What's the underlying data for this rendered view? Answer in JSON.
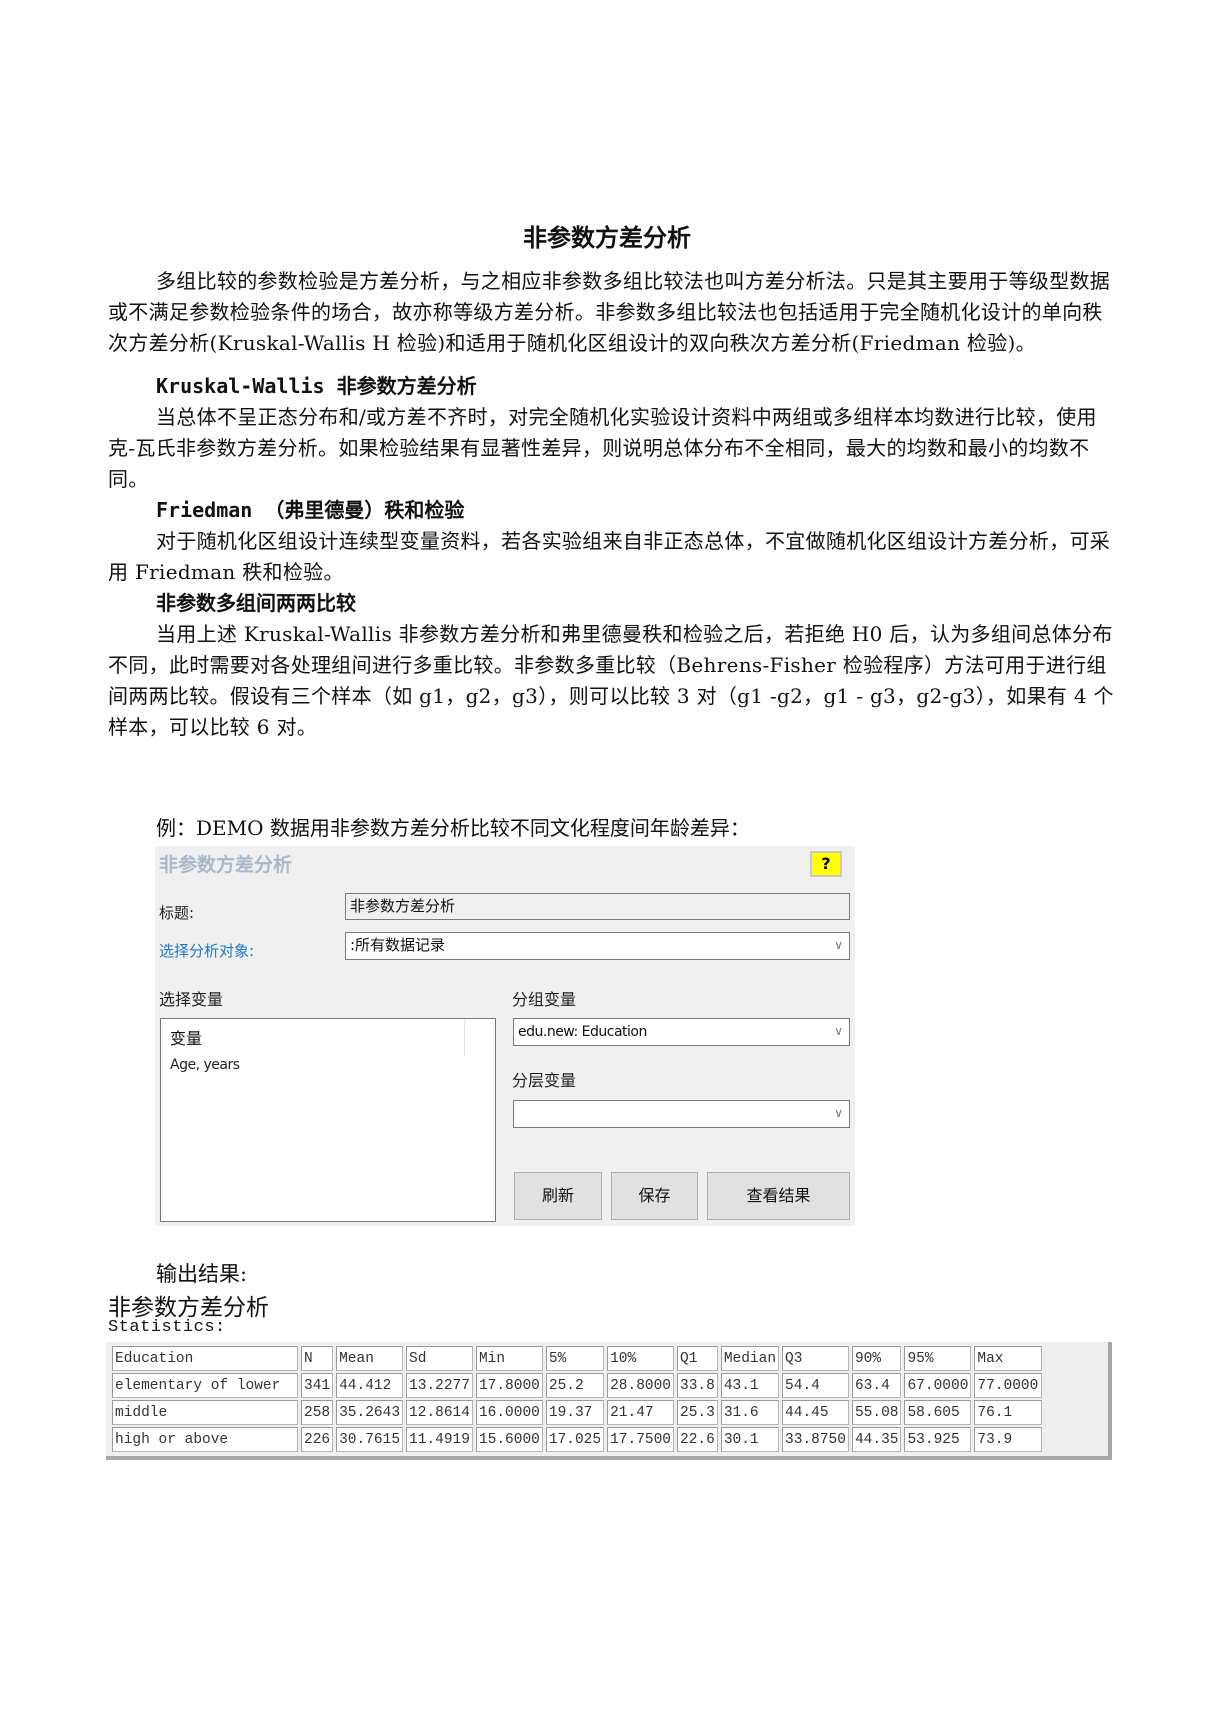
{
  "document": {
    "title": "非参数方差分析",
    "intro": "多组比较的参数检验是方差分析，与之相应非参数多组比较法也叫方差分析法。只是其主要用于等级型数据或不满足参数检验条件的场合，故亦称等级方差分析。非参数多组比较法也包括适用于完全随机化设计的单向秩次方差分析(Kruskal-Wallis H 检验)和适用于随机化区组设计的双向秩次方差分析(Friedman 检验)。",
    "sections": [
      {
        "heading_latin": "Kruskal-Wallis ",
        "heading_cn": "非参数方差分析",
        "body": "当总体不呈正态分布和/或方差不齐时，对完全随机化实验设计资料中两组或多组样本均数进行比较，使用克-瓦氏非参数方差分析。如果检验结果有显著性差异，则说明总体分布不全相同，最大的均数和最小的均数不同。"
      },
      {
        "heading_latin": "Friedman ",
        "heading_cn": "（弗里德曼）秩和检验",
        "body": "对于随机化区组设计连续型变量资料，若各实验组来自非正态总体，不宜做随机化区组设计方差分析，可采用 Friedman 秩和检验。"
      },
      {
        "heading_latin": "",
        "heading_cn": "非参数多组间两两比较",
        "body": "当用上述 Kruskal-Wallis 非参数方差分析和弗里德曼秩和检验之后，若拒绝 H0 后，认为多组间总体分布不同，此时需要对各处理组间进行多重比较。非参数多重比较（Behrens-Fisher 检验程序）方法可用于进行组间两两比较。假设有三个样本（如 g1，g2，g3），则可以比较 3 对（g1 -g2，g1 - g3，g2-g3），如果有 4 个样本，可以比较 6 对。"
      }
    ],
    "example_caption": "例：DEMO 数据用非参数方差分析比较不同文化程度间年龄差异："
  },
  "dialog": {
    "title": "非参数方差分析",
    "help_label": "?",
    "title_field_label": "标题:",
    "title_field_value": "非参数方差分析",
    "target_label": "选择分析对象:",
    "target_value": ":所有数据记录",
    "variables_label": "选择变量",
    "variables_header": "变量",
    "variables": [
      "Age, years"
    ],
    "group_label": "分组变量",
    "group_value": "edu.new: Education",
    "strata_label": "分层变量",
    "strata_value": "",
    "buttons": {
      "refresh": "刷新",
      "save": "保存",
      "view_results": "查看结果"
    },
    "colors": {
      "help_bg": "#ffff00",
      "link_label": "#1e78c8",
      "title": "#a9b8c9"
    }
  },
  "output": {
    "label": "输出结果:",
    "title": "非参数方差分析",
    "stats_label": "Statistics:",
    "table": {
      "headers": [
        "Education",
        "N",
        "Mean",
        "Sd",
        "Min",
        "5%",
        "10%",
        "Q1",
        "Median",
        "Q3",
        "90%",
        "95%",
        "Max"
      ],
      "rows": [
        [
          "elementary of lower",
          "341",
          "44.412",
          "13.2277",
          "17.8000",
          "25.2",
          "28.8000",
          "33.8",
          "43.1",
          "54.4",
          "63.4",
          "67.0000",
          "77.0000"
        ],
        [
          "middle",
          "258",
          "35.2643",
          "12.8614",
          "16.0000",
          "19.37",
          "21.47",
          "25.3",
          "31.6",
          "44.45",
          "55.08",
          "58.605",
          "76.1"
        ],
        [
          "high or above",
          "226",
          "30.7615",
          "11.4919",
          "15.6000",
          "17.025",
          "17.7500",
          "22.6",
          "30.1",
          "33.8750",
          "44.35",
          "53.925",
          "73.9"
        ]
      ]
    }
  }
}
